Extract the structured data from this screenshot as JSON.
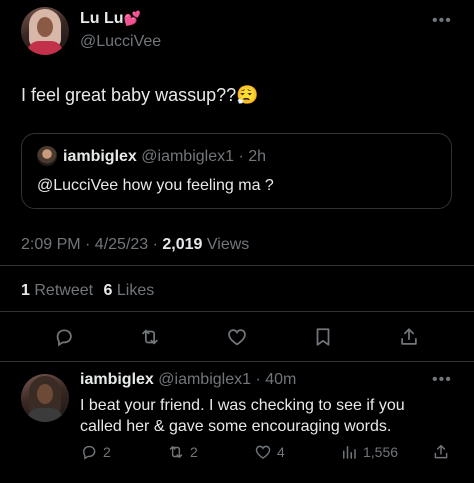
{
  "tweet": {
    "display_name": "Lu Lu",
    "name_emoji": "💕",
    "handle": "@LucciVee",
    "text": "I feel great baby wassup??😮‍💨",
    "quote": {
      "display_name": "iambiglex",
      "handle_time": "@iambiglex1 · 2h",
      "text": "@LucciVee how you feeling ma ?"
    },
    "meta": {
      "time_date": "2:09 PM · 4/25/23 · ",
      "views_count": "2,019",
      "views_label": " Views"
    },
    "stats": {
      "retweets_count": "1",
      "retweets_label": "Retweet",
      "likes_count": "6",
      "likes_label": "Likes"
    },
    "more_glyph": "•••"
  },
  "reply": {
    "display_name": "iambiglex",
    "handle_time": "@iambiglex1 · 40m",
    "text_line1": "I beat your friend. I was checking to see if you",
    "text_line2": "called her & gave some encouraging words.",
    "more_glyph": "•••",
    "actions": {
      "replies": "2",
      "retweets": "2",
      "likes": "4",
      "views": "1,556"
    }
  },
  "icons": {
    "actions": [
      "reply-icon",
      "retweet-icon",
      "like-icon",
      "bookmark-icon",
      "share-icon"
    ]
  }
}
